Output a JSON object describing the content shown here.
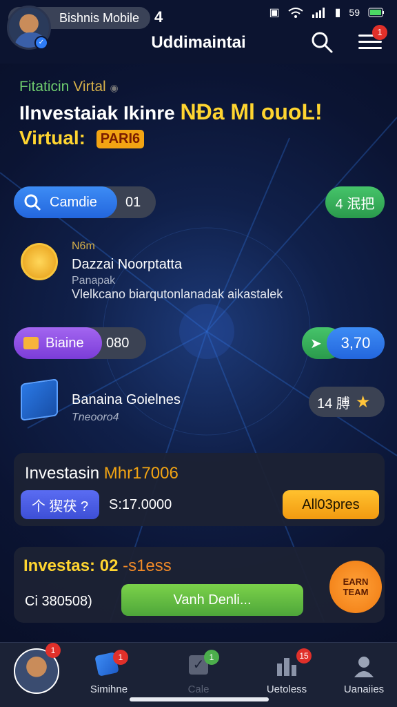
{
  "header": {
    "profile_name": "Bishnis Mobile",
    "notification_count": "4",
    "title": "Uddimaintai",
    "menu_badge": "1",
    "status_time": "59"
  },
  "hero": {
    "subtitle_green": "Fitaticin",
    "subtitle_gold": "Virtal",
    "line1_white": "Ilnvestaiak Ikinre",
    "line1_yellow": "NĐa Ml ouoĿ!",
    "line2": "Virtual:",
    "tag": "PARI6"
  },
  "row1": {
    "left_label": "Camdie",
    "left_value": "01",
    "right_label": "4 泯把"
  },
  "row2": {
    "tag": "N6m",
    "title": "Dazzai Noorptatta",
    "sub": "Panapak",
    "desc": "Vlelkcano biarqutonlanadak aikastalek"
  },
  "row3": {
    "left_label": "Biaine",
    "left_value": "080",
    "right_value": "3,70"
  },
  "row4": {
    "title": "Banaina Goielnes",
    "sub": "Tneooro4",
    "badge_value": "14 膊"
  },
  "card1": {
    "title_white": "Investasin",
    "title_gold": "Mhr17006",
    "action_label": "个 猰茯 ?",
    "amount": "S:17.0000",
    "cta_label": "All03pres"
  },
  "card2": {
    "title_gold": "Investas: 02",
    "title_orange": "-s1ess",
    "amount": "Ci 380508)",
    "cta_label": "Vanh Denli...",
    "earn_label": "EARN TEAM"
  },
  "nav": {
    "items": [
      {
        "label": "",
        "badge": "1"
      },
      {
        "label": "Simihne",
        "badge": "1"
      },
      {
        "label": "Cale",
        "badge": "1"
      },
      {
        "label": "Uetoless",
        "badge": "15"
      },
      {
        "label": "Uanaiies",
        "badge": ""
      }
    ]
  },
  "colors": {
    "accent_yellow": "#ffd530",
    "accent_orange": "#f2a413",
    "accent_green": "#46c46a",
    "accent_blue": "#3d8cf5",
    "accent_purple": "#a366f0",
    "background": "#0b1433"
  }
}
